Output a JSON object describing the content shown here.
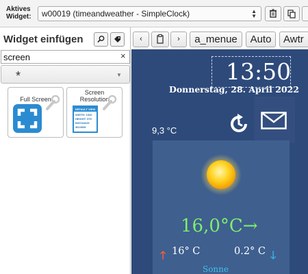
{
  "topbar": {
    "active_widget_label_line1": "Aktives",
    "active_widget_label_line2": "Widget:",
    "active_widget_value": "w00019 (timeandweather - SimpleClock)"
  },
  "left_panel": {
    "title": "Widget einfügen",
    "filter_value": "screen",
    "clear_symbol": "×",
    "widget_set_value": "*",
    "widgets": [
      {
        "label": "Full Screen"
      },
      {
        "label_line1": "Screen",
        "label_line2": "Resolution",
        "card_header": "DEFAULT VIEW",
        "card_lines": [
          "WIDTH: 1920",
          "HEIGHT: 979",
          "INSTANCE:",
          "3613936"
        ]
      }
    ]
  },
  "toolbar": {
    "prev": "‹",
    "next": "›",
    "view_name": "a_menue",
    "auto": "Auto",
    "awtr": "Awtr"
  },
  "canvas": {
    "clock_time": "13:50",
    "clock_date": "Donnerstag, 28. April 2022",
    "temp_now": "9,3 °C",
    "temp_main": "16,0°C→",
    "temp_high": "16° C",
    "temp_low": "0.2° C",
    "weather_text": "Sonne",
    "up_arrow": "🡑",
    "down_arrow": "🡓"
  },
  "colors": {
    "canvas_bg": "#2e4a7a",
    "temp_main": "#7dee6c",
    "weather_text": "#3fc0ea",
    "up_arrow": "#ef5f42",
    "down_arrow": "#3fa9e0",
    "accent_blue": "#2b8bd1"
  },
  "icons": [
    "trash-icon",
    "copy-icon",
    "search-icon",
    "tag-icon",
    "clipboard-icon",
    "fullscreen-icon",
    "wrench-icon",
    "refresh-icon",
    "mail-icon",
    "sun-icon"
  ]
}
